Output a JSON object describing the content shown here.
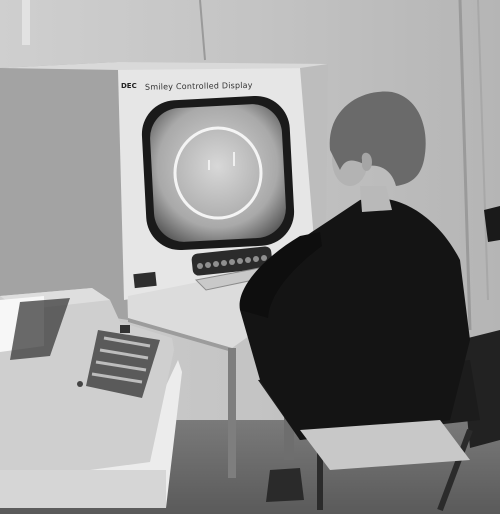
{
  "photo": {
    "console_brand": "DEC",
    "console_label": "Smiley Controlled Display"
  }
}
